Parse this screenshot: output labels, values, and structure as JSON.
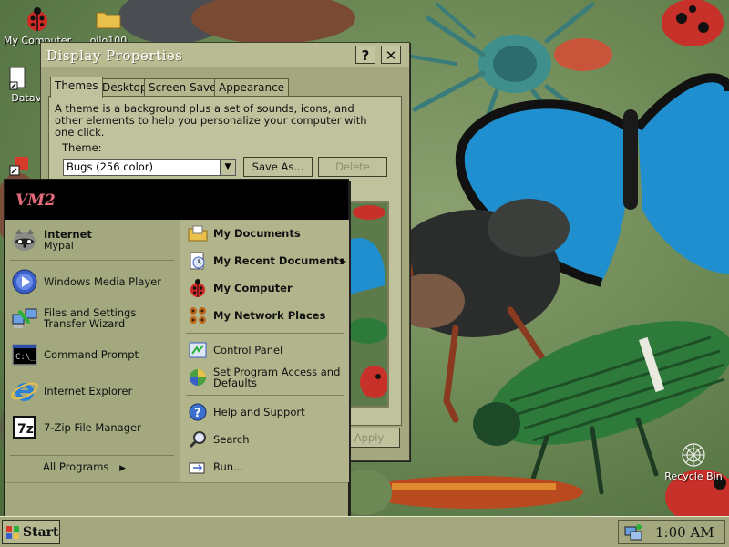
{
  "desktop": {
    "icons": [
      {
        "label": "My Computer"
      },
      {
        "label": "DataVa"
      },
      {
        "label": "Recycle Bin"
      }
    ],
    "partial_folder_label": "ollo100"
  },
  "dialog": {
    "title": "Display Properties",
    "help_btn": "?",
    "close_btn": "✕",
    "tabs": [
      "Themes",
      "Desktop",
      "Screen Saver",
      "Appearance"
    ],
    "description": "A theme is a background plus a set of sounds, icons, and other elements to help you personalize your computer with one click.",
    "theme_label": "Theme:",
    "theme_value": "Bugs (256 color)",
    "save_as": "Save As...",
    "delete": "Delete",
    "apply": "Apply"
  },
  "start_menu": {
    "user": "VM2",
    "left_items": [
      {
        "title": "Internet",
        "subtitle": "Mypal",
        "icon": "raccoon-browser-icon"
      },
      {
        "title": "Windows Media Player",
        "icon": "media-player-icon"
      },
      {
        "title": "Files and Settings Transfer Wizard",
        "icon": "transfer-wizard-icon"
      },
      {
        "title": "Command Prompt",
        "icon": "command-prompt-icon"
      },
      {
        "title": "Internet Explorer",
        "icon": "internet-explorer-icon"
      },
      {
        "title": "7-Zip File Manager",
        "icon": "7zip-icon"
      }
    ],
    "all_programs": "All Programs",
    "right_items": [
      {
        "title": "My Documents",
        "icon": "folder-icon",
        "bold": true
      },
      {
        "title": "My Recent Documents",
        "icon": "recent-docs-icon",
        "bold": true,
        "arrow": true
      },
      {
        "title": "My Computer",
        "icon": "ladybug-icon",
        "bold": true
      },
      {
        "title": "My Network Places",
        "icon": "network-icon",
        "bold": true
      },
      {
        "title": "Control Panel",
        "icon": "control-panel-icon"
      },
      {
        "title": "Set Program Access and Defaults",
        "icon": "program-access-icon"
      },
      {
        "title": "Help and Support",
        "icon": "help-icon"
      },
      {
        "title": "Search",
        "icon": "search-icon"
      },
      {
        "title": "Run...",
        "icon": "run-icon"
      }
    ]
  },
  "taskbar": {
    "start_label": "Start",
    "clock": "1:00 AM"
  },
  "colors": {
    "window_face": "#a4a87f",
    "panel": "#c0c29d",
    "header": "#000000",
    "user_name": "#e26a7a"
  }
}
